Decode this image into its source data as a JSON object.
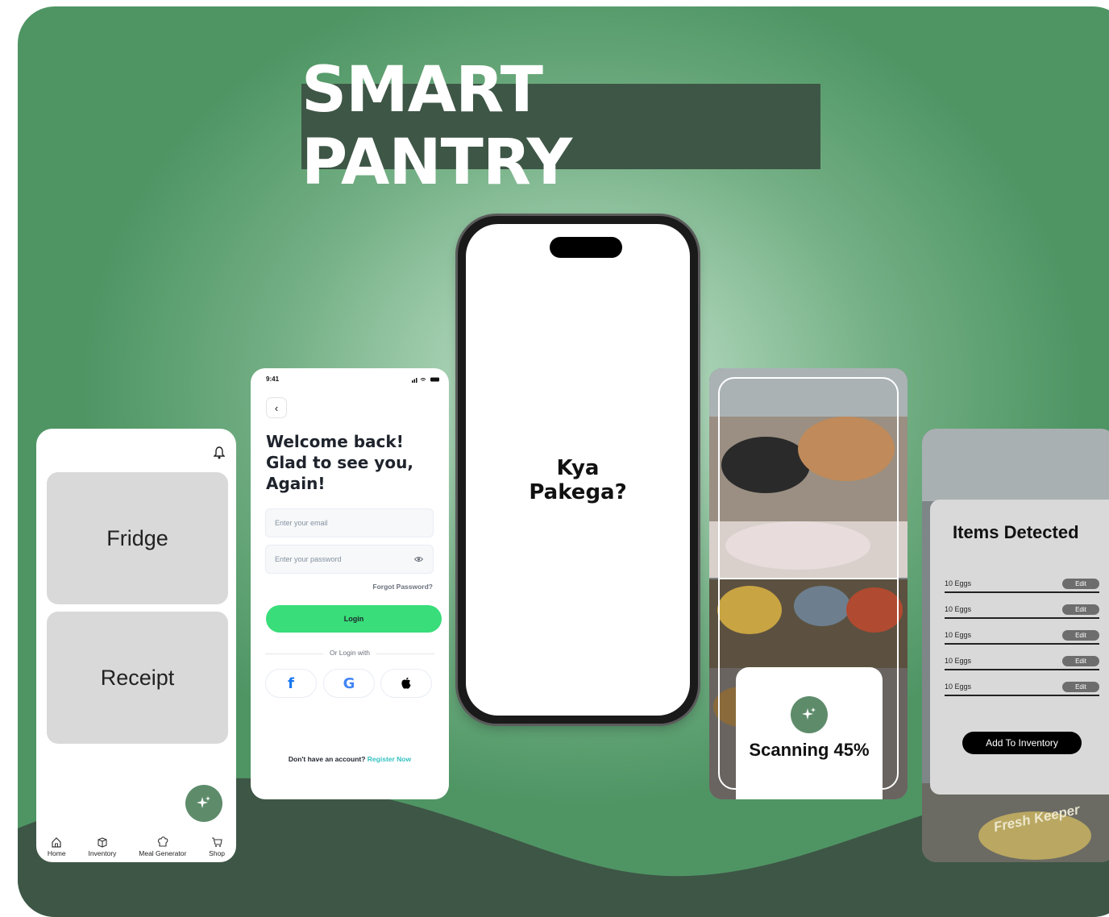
{
  "hero": {
    "title": "SMART PANTRY"
  },
  "home_screen": {
    "tiles": [
      "Fridge",
      "Receipt"
    ],
    "nav": [
      {
        "label": "Home",
        "icon": "home-icon"
      },
      {
        "label": "Inventory",
        "icon": "box-icon"
      },
      {
        "label": "Meal Generator",
        "icon": "chef-hat-icon"
      },
      {
        "label": "Shop",
        "icon": "cart-icon"
      }
    ]
  },
  "login_screen": {
    "time": "9:41",
    "heading": "Welcome back! Glad to see you, Again!",
    "email_placeholder": "Enter your email",
    "password_placeholder": "Enter your password",
    "forgot": "Forgot Password?",
    "login_label": "Login",
    "or_label": "Or Login with",
    "social": [
      "f",
      "G",
      ""
    ],
    "register_prompt": "Don't have an account?",
    "register_link": "Register Now"
  },
  "splash_screen": {
    "line1": "Kya",
    "line2": "Pakega?"
  },
  "scan_screen": {
    "label": "Scanning 45%",
    "progress_percent": 45
  },
  "items_screen": {
    "title": "Items Detected",
    "items": [
      "10 Eggs",
      "10 Eggs",
      "10 Eggs",
      "10 Eggs",
      "10 Eggs"
    ],
    "edit_label": "Edit",
    "add_label": "Add To Inventory",
    "container_text": "Fresh Keeper"
  },
  "colors": {
    "accent_green": "#39dd79",
    "fab_green": "#5e8c6b",
    "title_bg": "#3e5646",
    "link": "#35c2c1"
  }
}
